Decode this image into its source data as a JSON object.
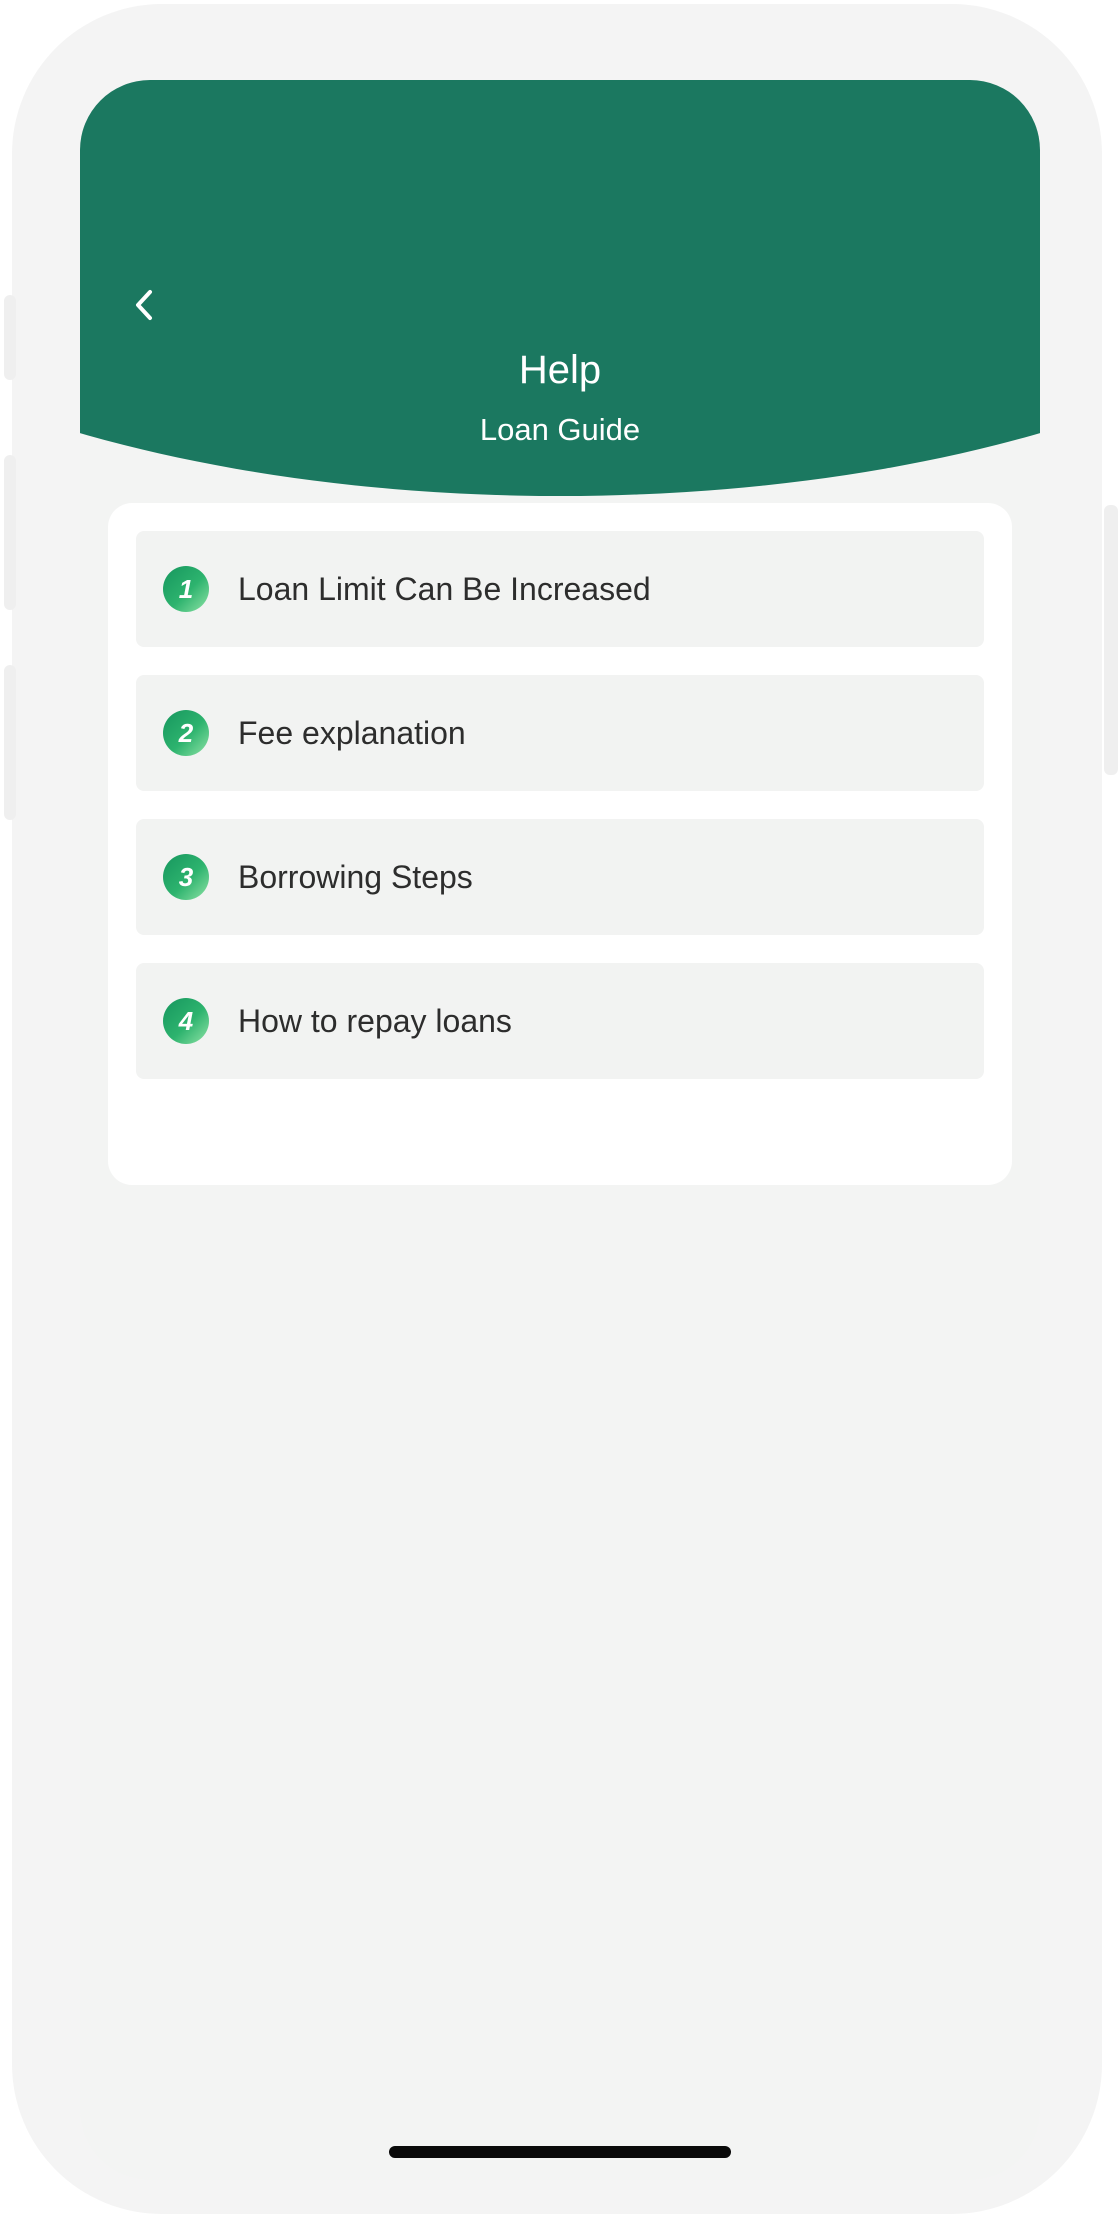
{
  "header": {
    "title": "Help",
    "subtitle": "Loan Guide",
    "back_icon": "chevron-left-icon",
    "background_color": "#1b7860"
  },
  "guide": {
    "items": [
      {
        "number": "1",
        "label": "Loan Limit Can Be Increased"
      },
      {
        "number": "2",
        "label": "Fee explanation"
      },
      {
        "number": "3",
        "label": "Borrowing Steps"
      },
      {
        "number": "4",
        "label": "How to repay loans"
      }
    ]
  },
  "colors": {
    "accent": "#1b7860",
    "badge_gradient_start": "#16965e",
    "badge_gradient_end": "#8fe3a6",
    "screen_background": "#f3f4f3"
  }
}
